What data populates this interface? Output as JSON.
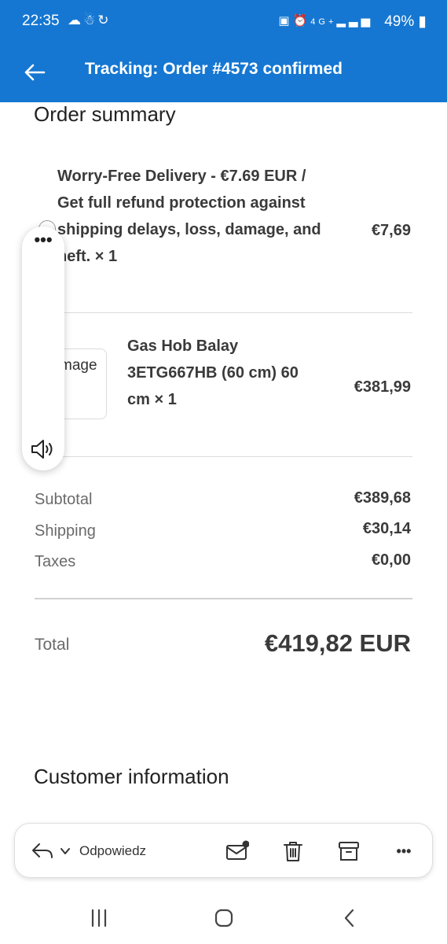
{
  "status_bar": {
    "time": "22:35",
    "left_icons": [
      "cloud-icon",
      "accessibility-icon",
      "sync-icon"
    ],
    "network": "4G+",
    "battery": "49%"
  },
  "header": {
    "title": "Tracking: Order #4573 confirmed"
  },
  "order_summary": {
    "title": "Order summary",
    "items": [
      {
        "name_lines": [
          "Worry-Free Delivery - €7.69 EUR /",
          "Get full refund protection against",
          "shipping delays, loss, damage, and",
          "heft. × 1"
        ],
        "price": "€7,69"
      },
      {
        "image_alt": "mage",
        "name_lines": [
          "Gas Hob Balay",
          "3ETG667HB (60 cm) 60",
          "cm × 1"
        ],
        "price": "€381,99"
      }
    ],
    "subtotal_label": "Subtotal",
    "subtotal_value": "€389,68",
    "shipping_label": "Shipping",
    "shipping_value": "€30,14",
    "taxes_label": "Taxes",
    "taxes_value": "€0,00",
    "total_label": "Total",
    "total_value": "€419,82 EUR"
  },
  "customer_information": {
    "title": "Customer information"
  },
  "side_panel": {
    "more_label": "•••"
  },
  "action_bar": {
    "reply_label": "Odpowiedz",
    "icons": [
      "reply-icon",
      "chevron-down-icon",
      "mark-unread-icon",
      "trash-icon",
      "archive-icon",
      "more-icon"
    ],
    "more_label": "•••"
  },
  "navigation": {
    "icons": [
      "recent-apps-icon",
      "home-icon",
      "back-icon"
    ]
  },
  "colors": {
    "header_bg": "#1577d2",
    "text_primary": "#3a3a3a",
    "text_secondary": "#6a6a6a"
  }
}
